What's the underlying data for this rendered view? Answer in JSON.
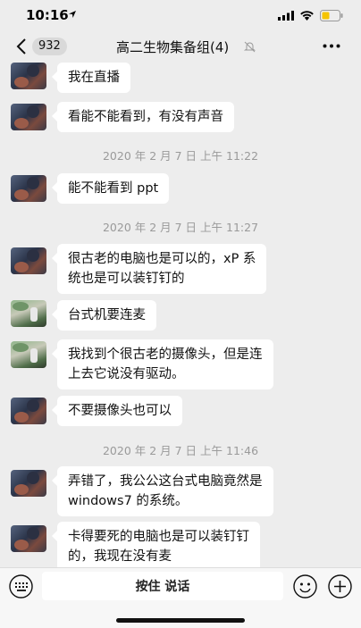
{
  "status": {
    "time": "10:16"
  },
  "nav": {
    "unread_count": "932",
    "title": "高二生物集备组(4)"
  },
  "messages": [
    {
      "type": "text",
      "avatar": "a",
      "text": "我在直播"
    },
    {
      "type": "text",
      "avatar": "a",
      "text": "看能不能看到，有没有声音"
    },
    {
      "type": "time",
      "text": "2020 年 2 月 7 日  上午 11:22"
    },
    {
      "type": "text",
      "avatar": "a",
      "text": "能不能看到 ppt"
    },
    {
      "type": "time",
      "text": "2020 年 2 月 7 日  上午 11:27"
    },
    {
      "type": "text",
      "avatar": "a",
      "lines": [
        "很古老的电脑也是可以的，xP 系",
        "统也是可以装钉钉的"
      ]
    },
    {
      "type": "text",
      "avatar": "b",
      "text": "台式机要连麦"
    },
    {
      "type": "text",
      "avatar": "b",
      "lines": [
        "我找到个很古老的摄像头，但是连",
        "上去它说没有驱动。"
      ]
    },
    {
      "type": "text",
      "avatar": "a",
      "text": "不要摄像头也可以"
    },
    {
      "type": "time",
      "text": "2020 年 2 月 7 日  上午 11:46"
    },
    {
      "type": "text",
      "avatar": "a",
      "lines": [
        "弄错了，我公公这台式电脑竟然是",
        "windows7 的系统。"
      ]
    },
    {
      "type": "text",
      "avatar": "a",
      "lines": [
        "卡得要死的电脑也是可以装钉钉",
        "的，我现在没有麦"
      ]
    }
  ],
  "input_bar": {
    "hold_to_talk_label": "按住 说话"
  },
  "icons": {
    "back": "chevron-left-icon",
    "mute": "bell-off-icon",
    "more": "more-dots-icon",
    "keyboard": "keyboard-icon",
    "emoji": "emoji-icon",
    "plus": "plus-circle-icon"
  },
  "colors": {
    "background": "#ededed",
    "bubble": "#ffffff",
    "timestamp": "#9a9a9a",
    "battery": "#f5c400"
  }
}
